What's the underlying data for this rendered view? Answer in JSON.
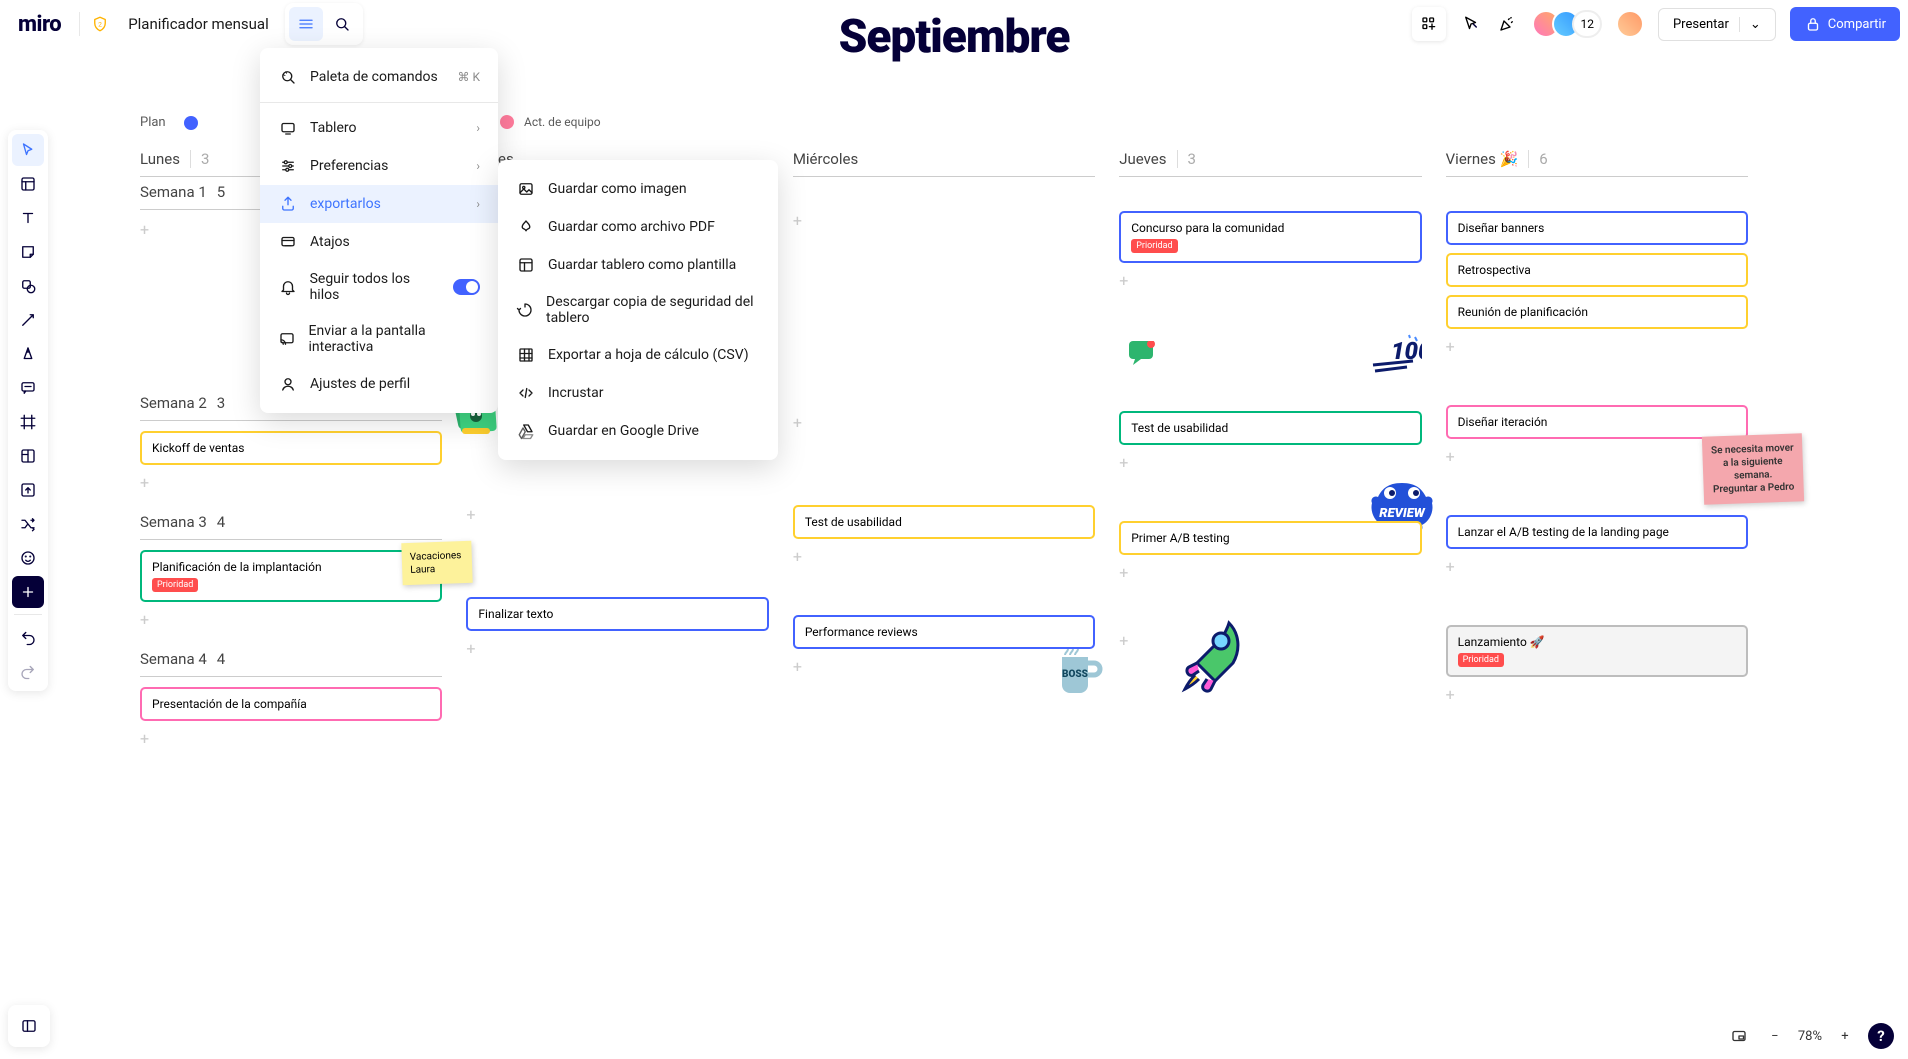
{
  "app": {
    "logo": "miro",
    "board_name": "Planificador mensual"
  },
  "topbar": {
    "present": "Presentar",
    "share": "Compartir",
    "avatar_count": "12"
  },
  "title": "Septiembre",
  "legend": {
    "plan": "Plan",
    "team": "Act. de equipo"
  },
  "menu": {
    "commands": "Paleta de comandos",
    "commands_shortcut": "⌘ K",
    "board": "Tablero",
    "prefs": "Preferencias",
    "export": "exportarlos",
    "shortcuts": "Atajos",
    "follow": "Seguir todos los hilos",
    "cast": "Enviar a la pantalla interactiva",
    "profile": "Ajustes de perfil"
  },
  "submenu": {
    "image": "Guardar como imagen",
    "pdf": "Guardar como archivo PDF",
    "template": "Guardar tablero como plantilla",
    "backup": "Descargar copia de seguridad del tablero",
    "csv": "Exportar a hoja de cálculo (CSV)",
    "embed": "Incrustar",
    "drive": "Guardar en Google Drive"
  },
  "columns": [
    {
      "name": "Lunes",
      "count": "3"
    },
    {
      "name": "Martes",
      "count": ""
    },
    {
      "name": "Miércoles",
      "count": ""
    },
    {
      "name": "Jueves",
      "count": "3"
    },
    {
      "name": "Viernes 🎉",
      "count": "6"
    }
  ],
  "weeks": [
    {
      "label": "Semana 1",
      "cnt": "5"
    },
    {
      "label": "Semana 2",
      "cnt": "3"
    },
    {
      "label": "Semana 3",
      "cnt": "4"
    },
    {
      "label": "Semana 4",
      "cnt": "4"
    }
  ],
  "cards": {
    "w1_jue": {
      "text": "Concurso para la comunidad",
      "tag": "Prioridad",
      "color": "#4262ff"
    },
    "w1_vie_a": {
      "text": "Diseñar banners",
      "color": "#4262ff"
    },
    "w1_vie_b": {
      "text": "Retrospectiva",
      "color": "#ffd02f"
    },
    "w1_vie_c": {
      "text": "Reunión de planificación",
      "color": "#ffd02f"
    },
    "w2_lun": {
      "text": "Kickoff de ventas",
      "color": "#ffd02f"
    },
    "w2_jue": {
      "text": "Test de usabilidad",
      "color": "#00b87c"
    },
    "w2_vie": {
      "text": "Diseñar iteración",
      "color": "#ff6bb2"
    },
    "w3_lun": {
      "text": "Planificación de la implantación",
      "tag": "Prioridad",
      "color": "#00b87c"
    },
    "w3_mie": {
      "text": "Test de usabilidad",
      "color": "#ffd02f"
    },
    "w3_jue": {
      "text": "Primer A/B testing",
      "color": "#ffd02f"
    },
    "w3_vie": {
      "text": "Lanzar el A/B testing de la landing page",
      "color": "#4262ff"
    },
    "w4_lun": {
      "text": "Presentación de la compañía",
      "color": "#ff6bb2"
    },
    "w4_mar": {
      "text": "Finalizar texto",
      "color": "#4262ff"
    },
    "w4_mie": {
      "text": "Performance reviews",
      "color": "#4262ff"
    },
    "w4_vie": {
      "text": "Lanzamiento 🚀",
      "tag": "Prioridad",
      "color": "#bdbdbd"
    }
  },
  "stickies": {
    "vacaciones": "Vacaciones Laura",
    "pink": "Se necesita mover a la siguiente semana. Preguntar a Pedro"
  },
  "zoom": {
    "level": "78%"
  }
}
